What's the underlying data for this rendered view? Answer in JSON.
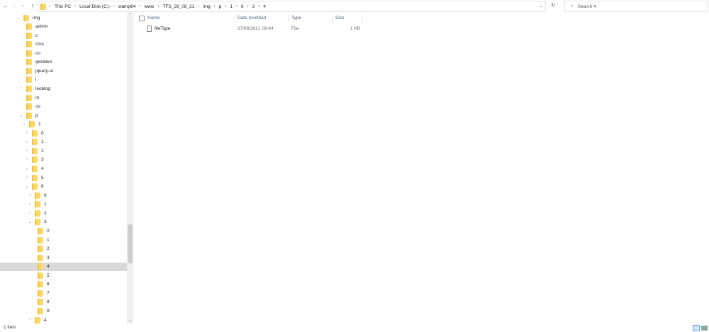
{
  "nav": {
    "back": "←",
    "forward": "→",
    "recent": "⌄",
    "up": "↑"
  },
  "address": {
    "crumbs": [
      "This PC",
      "Local Disk (C:)",
      "wamp64",
      "www",
      "TFS_26_08_21",
      "img",
      "p",
      "1",
      "6",
      "3",
      "4"
    ],
    "dropdown": "⌄",
    "refresh": "↻"
  },
  "search": {
    "placeholder": "Search 4",
    "icon": "⌕"
  },
  "tree": [
    {
      "label": "img",
      "level": 0,
      "state": "open"
    },
    {
      "label": "admin",
      "level": 1,
      "state": "none"
    },
    {
      "label": "c",
      "level": 1,
      "state": "none"
    },
    {
      "label": "cms",
      "level": 1,
      "state": "none"
    },
    {
      "label": "co",
      "level": 1,
      "state": "none"
    },
    {
      "label": "genders",
      "level": 1,
      "state": "none"
    },
    {
      "label": "jquery-ui",
      "level": 1,
      "state": "none"
    },
    {
      "label": "l",
      "level": 1,
      "state": "none"
    },
    {
      "label": "leoblog",
      "level": 1,
      "state": "closed"
    },
    {
      "label": "m",
      "level": 1,
      "state": "none"
    },
    {
      "label": "os",
      "level": 1,
      "state": "none"
    },
    {
      "label": "p",
      "level": 1,
      "state": "open"
    },
    {
      "label": "1",
      "level": 2,
      "state": "open"
    },
    {
      "label": "0",
      "level": 3,
      "state": "closed"
    },
    {
      "label": "1",
      "level": 3,
      "state": "closed"
    },
    {
      "label": "2",
      "level": 3,
      "state": "closed"
    },
    {
      "label": "3",
      "level": 3,
      "state": "closed"
    },
    {
      "label": "4",
      "level": 3,
      "state": "closed"
    },
    {
      "label": "5",
      "level": 3,
      "state": "closed"
    },
    {
      "label": "6",
      "level": 3,
      "state": "open"
    },
    {
      "label": "0",
      "level": 4,
      "state": "closed"
    },
    {
      "label": "1",
      "level": 4,
      "state": "closed"
    },
    {
      "label": "2",
      "level": 4,
      "state": "closed"
    },
    {
      "label": "3",
      "level": 4,
      "state": "open"
    },
    {
      "label": "0",
      "level": 5,
      "state": "none"
    },
    {
      "label": "1",
      "level": 5,
      "state": "none"
    },
    {
      "label": "2",
      "level": 5,
      "state": "none"
    },
    {
      "label": "3",
      "level": 5,
      "state": "none"
    },
    {
      "label": "4",
      "level": 5,
      "state": "none",
      "selected": true
    },
    {
      "label": "5",
      "level": 5,
      "state": "none"
    },
    {
      "label": "6",
      "level": 5,
      "state": "none"
    },
    {
      "label": "7",
      "level": 5,
      "state": "none"
    },
    {
      "label": "8",
      "level": 5,
      "state": "none"
    },
    {
      "label": "9",
      "level": 5,
      "state": "none"
    },
    {
      "label": "4",
      "level": 4,
      "state": "closed"
    }
  ],
  "columns": {
    "name": "Name",
    "date": "Date modified",
    "type": "Type",
    "size": "Size"
  },
  "files": [
    {
      "name": "fileType",
      "date": "27/08/2021 09:44",
      "type": "File",
      "size": "1 KB"
    }
  ],
  "status": {
    "count": "1 item"
  }
}
